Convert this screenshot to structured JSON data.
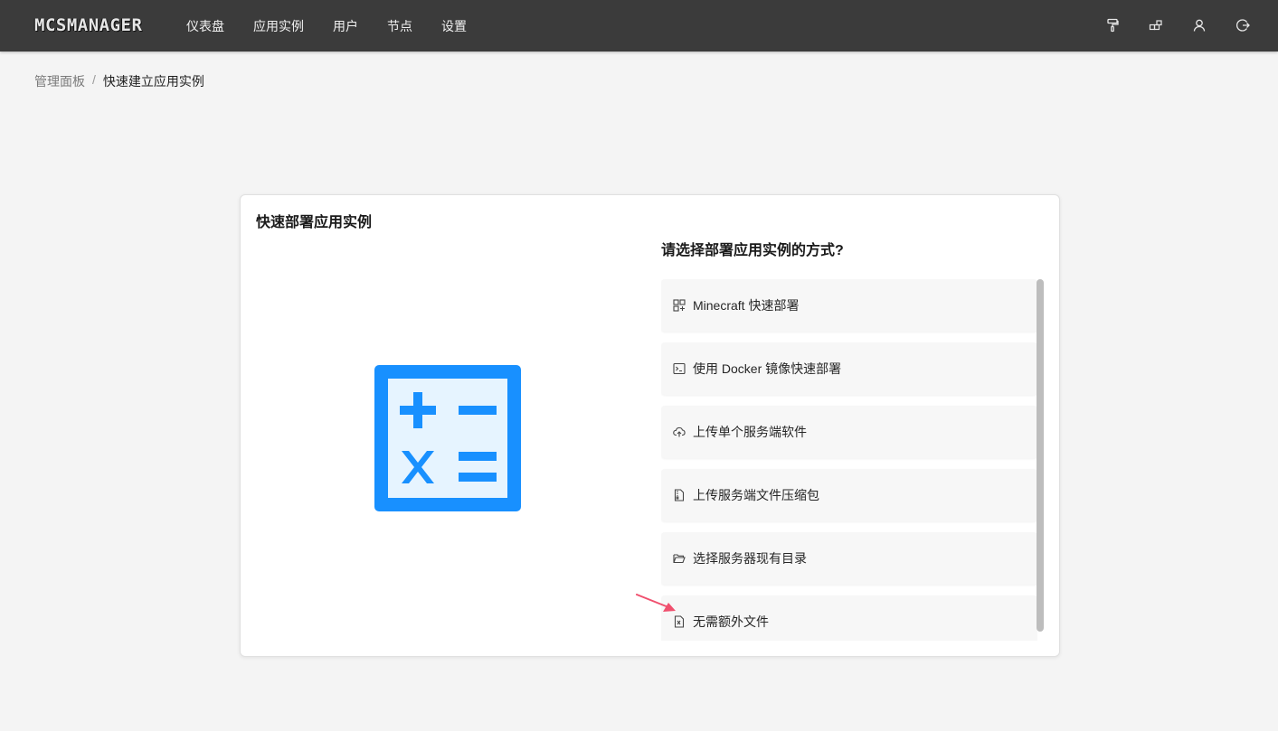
{
  "app": {
    "logo_text": "MCSMANAGER",
    "nav": [
      "仪表盘",
      "应用实例",
      "用户",
      "节点",
      "设置"
    ],
    "header_actions": [
      "paint-roller-icon",
      "blocks-icon",
      "user-icon",
      "logout-icon"
    ]
  },
  "breadcrumb": {
    "root": "管理面板",
    "separator": "/",
    "current": "快速建立应用实例"
  },
  "card": {
    "title": "快速部署应用实例",
    "illustration": "calculator-icon",
    "question": "请选择部署应用实例的方式?",
    "options": [
      {
        "label": "Minecraft 快速部署",
        "icon": "apps-icon"
      },
      {
        "label": "使用 Docker 镜像快速部署",
        "icon": "terminal-icon"
      },
      {
        "label": "上传单个服务端软件",
        "icon": "cloud-upload-icon"
      },
      {
        "label": "上传服务端文件压缩包",
        "icon": "file-zip-icon"
      },
      {
        "label": "选择服务器现有目录",
        "icon": "folder-open-icon"
      },
      {
        "label": "无需额外文件",
        "icon": "file-excel-icon"
      }
    ]
  },
  "colors": {
    "topbar": "#3b3b3b",
    "accent": "#1890ff",
    "illustration_fill": "#e6f4ff",
    "annotation_arrow": "#f0506e"
  }
}
